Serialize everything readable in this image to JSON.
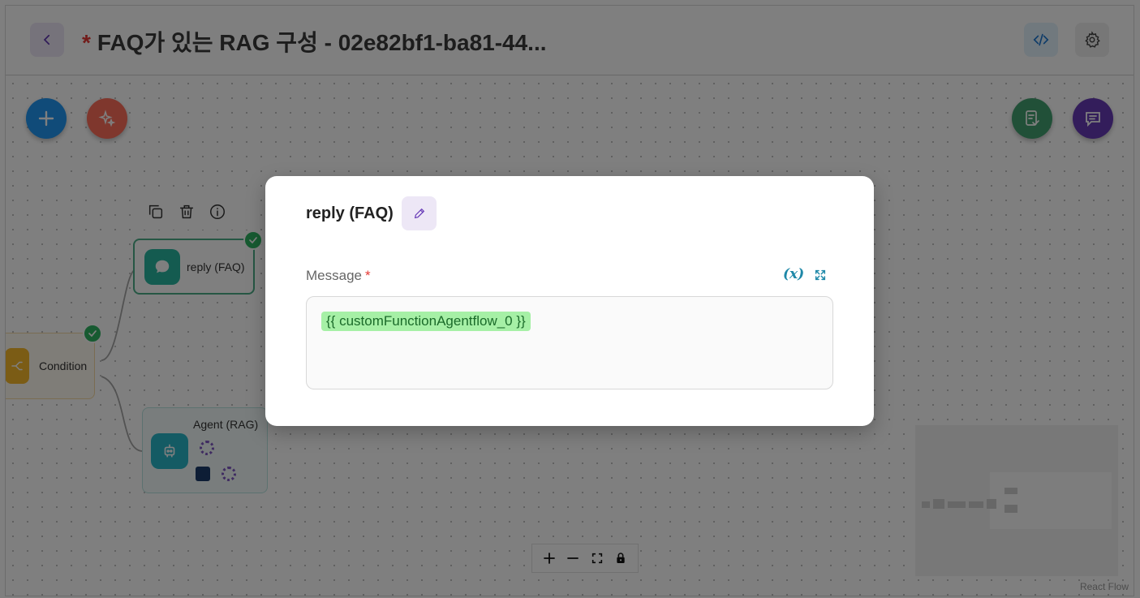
{
  "header": {
    "unsaved_marker": "*",
    "title": "FAQ가 있는 RAG 구성 - 02e82bf1-ba81-44..."
  },
  "canvas": {
    "nodes": {
      "reply": {
        "label": "reply (FAQ)",
        "status": "valid"
      },
      "condition": {
        "label": "Condition",
        "status": "valid"
      },
      "agent": {
        "label": "Agent (RAG)"
      }
    },
    "attribution": "React Flow"
  },
  "dialog": {
    "node_name": "reply (FAQ)",
    "field_label": "Message",
    "required_marker": "*",
    "variable_button": "(x)",
    "message_value": "{{ customFunctionAgentflow_0 }}"
  },
  "colors": {
    "accent_purple": "#673ab7",
    "primary_blue": "#2196f3",
    "success_green": "#2fb463",
    "variable_chip": "#a6f0a6",
    "overlay": "rgba(0,0,0,0.5)"
  }
}
